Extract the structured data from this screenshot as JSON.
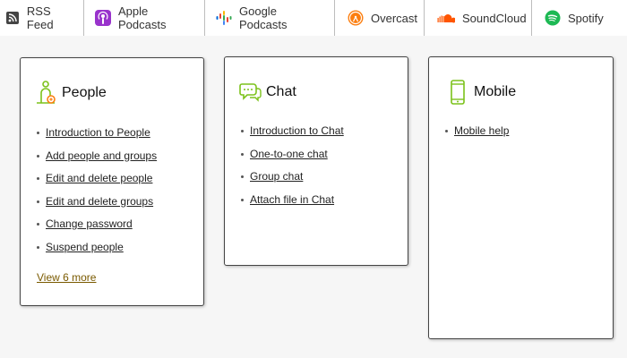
{
  "podcast_bar": [
    {
      "label": "RSS Feed",
      "icon": "rss-icon",
      "color": "#444444"
    },
    {
      "label": "Apple Podcasts",
      "icon": "apple-podcasts-icon",
      "color": "#9933cc"
    },
    {
      "label": "Google Podcasts",
      "icon": "google-podcasts-icon",
      "color": "#4285f4"
    },
    {
      "label": "Overcast",
      "icon": "overcast-icon",
      "color": "#fc7e0f"
    },
    {
      "label": "SoundCloud",
      "icon": "soundcloud-icon",
      "color": "#ff5500"
    },
    {
      "label": "Spotify",
      "icon": "spotify-icon",
      "color": "#1db954"
    }
  ],
  "cards": {
    "people": {
      "title": "People",
      "icon": "people-icon",
      "links": [
        "Introduction to People",
        "Add people and groups",
        "Edit and delete people",
        "Edit and delete groups",
        "Change password",
        "Suspend people"
      ],
      "more": "View 6 more"
    },
    "chat": {
      "title": "Chat",
      "icon": "chat-icon",
      "links": [
        "Introduction to Chat",
        "One-to-one chat",
        "Group chat",
        "Attach file in Chat"
      ]
    },
    "mobile": {
      "title": "Mobile",
      "icon": "mobile-icon",
      "links": [
        "Mobile help"
      ]
    }
  },
  "colors": {
    "icon_green": "#7cc21b",
    "more_link": "#7a5a00"
  }
}
